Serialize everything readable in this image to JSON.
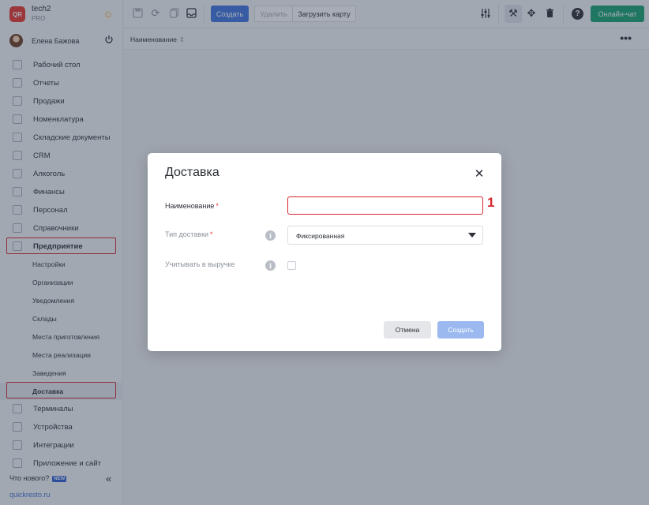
{
  "brand": {
    "logo_text": "QR",
    "name": "tech2",
    "plan": "PRO"
  },
  "user": {
    "name": "Елена Бажова"
  },
  "sidebar": {
    "items": [
      {
        "label": "Рабочий стол"
      },
      {
        "label": "Отчеты"
      },
      {
        "label": "Продажи"
      },
      {
        "label": "Номенклатура"
      },
      {
        "label": "Складские документы"
      },
      {
        "label": "CRM"
      },
      {
        "label": "Алкоголь"
      },
      {
        "label": "Финансы"
      },
      {
        "label": "Персонал"
      },
      {
        "label": "Справочники"
      },
      {
        "label": "Предприятие"
      }
    ],
    "subitems": [
      {
        "label": "Настройки"
      },
      {
        "label": "Организации"
      },
      {
        "label": "Уведомления"
      },
      {
        "label": "Склады"
      },
      {
        "label": "Места приготовления"
      },
      {
        "label": "Места реализации"
      },
      {
        "label": "Заведения"
      },
      {
        "label": "Доставка"
      }
    ],
    "items_after": [
      {
        "label": "Терминалы"
      },
      {
        "label": "Устройства"
      },
      {
        "label": "Интеграции"
      },
      {
        "label": "Приложение и сайт"
      }
    ],
    "whats_new": "Что нового?",
    "new_badge": "NEW",
    "site_link": "quickresto.ru"
  },
  "toolbar": {
    "create_label": "Создать",
    "delete_label": "Удалить",
    "load_map_label": "Загрузить карту",
    "chat_label": "Онлайн-чат",
    "help_glyph": "?"
  },
  "list": {
    "column_name": "Наименование"
  },
  "modal": {
    "title": "Доставка",
    "name_label": "Наименование",
    "required_mark": "*",
    "name_value": "",
    "type_label": "Тип доставки",
    "type_value": "Фиксированная",
    "revenue_label": "Учитывать в выручке",
    "revenue_checked": false,
    "cancel_label": "Отмена",
    "submit_label": "Создать"
  },
  "callout": {
    "number": "1"
  },
  "colors": {
    "accent": "#3d74e0",
    "chat": "#13a36f",
    "highlight": "#d6262d",
    "logo": "#e8322d"
  }
}
